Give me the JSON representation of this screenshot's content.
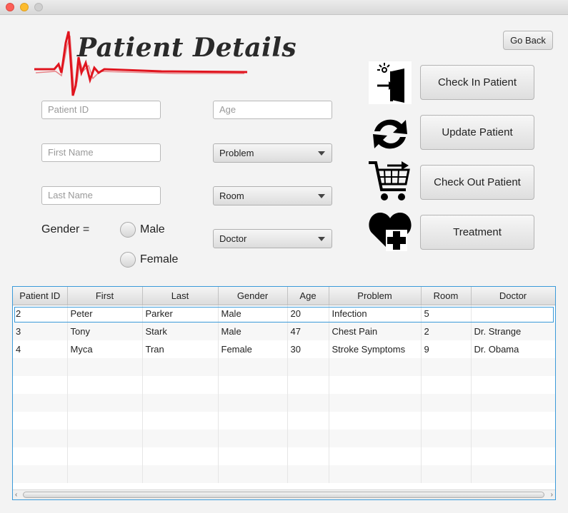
{
  "window": {
    "controls": [
      "close",
      "minimize",
      "maximize"
    ]
  },
  "header": {
    "title": "Patient Details",
    "go_back_label": "Go Back"
  },
  "form": {
    "patient_id_placeholder": "Patient ID",
    "age_placeholder": "Age",
    "first_name_placeholder": "First Name",
    "last_name_placeholder": "Last Name",
    "problem_combo": "Problem",
    "room_combo": "Room",
    "doctor_combo": "Doctor",
    "gender_label": "Gender =",
    "gender_male": "Male",
    "gender_female": "Female"
  },
  "actions": {
    "check_in_label": "Check In Patient",
    "update_label": "Update Patient",
    "check_out_label": "Check Out Patient",
    "treatment_label": "Treatment",
    "check_in_icon": "door-enter-icon",
    "update_icon": "refresh-icon",
    "check_out_icon": "cart-icon",
    "treatment_icon": "heart-plus-icon"
  },
  "table": {
    "columns": [
      "Patient ID",
      "First",
      "Last",
      "Gender",
      "Age",
      "Problem",
      "Room",
      "Doctor"
    ],
    "rows": [
      [
        "2",
        "Peter",
        "Parker",
        "Male",
        "20",
        "Infection",
        "5",
        ""
      ],
      [
        "3",
        "Tony",
        "Stark",
        "Male",
        "47",
        "Chest Pain",
        "2",
        "Dr. Strange"
      ],
      [
        "4",
        "Myca",
        "Tran",
        "Female",
        "30",
        "Stroke Symptoms",
        "9",
        "Dr. Obama"
      ]
    ]
  },
  "colors": {
    "selection": "#3a9ad9",
    "logo_line": "#e0141e"
  }
}
